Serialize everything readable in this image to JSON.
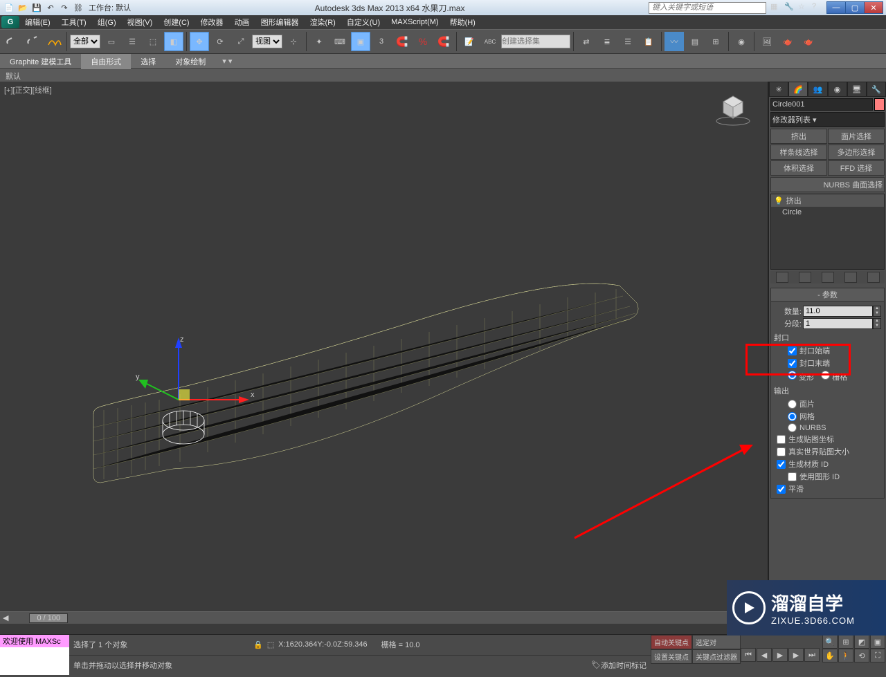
{
  "titlebar": {
    "workspace_label": "工作台: 默认",
    "title": "Autodesk 3ds Max  2013 x64     水果刀.max",
    "search_placeholder": "键入关键字或短语"
  },
  "menu": {
    "items": [
      "编辑(E)",
      "工具(T)",
      "组(G)",
      "视图(V)",
      "创建(C)",
      "修改器",
      "动画",
      "图形编辑器",
      "渲染(R)",
      "自定义(U)",
      "MAXScript(M)",
      "帮助(H)"
    ]
  },
  "maintb": {
    "filter": "全部",
    "view_dd": "视图",
    "named_set_placeholder": "创建选择集"
  },
  "shelf": {
    "tabs": [
      "Graphite 建模工具",
      "自由形式",
      "选择",
      "对象绘制"
    ],
    "active": 1,
    "sub": "默认"
  },
  "viewport": {
    "label": "[+][正交][线框]"
  },
  "cmd_panel": {
    "object_name": "Circle001",
    "modlist_label": "修改器列表",
    "mod_buttons": [
      "挤出",
      "面片选择",
      "样条线选择",
      "多边形选择",
      "体积选择",
      "FFD 选择"
    ],
    "mod_row": "NURBS 曲面选择",
    "stack": {
      "header": "挤出",
      "item": "Circle"
    },
    "params": {
      "rollout": "参数",
      "amount_label": "数量:",
      "amount_value": "11.0",
      "segments_label": "分段:",
      "segments_value": "1",
      "cap_label": "封口",
      "cap_start": "封口始端",
      "cap_end": "封口末端",
      "morph": "变形",
      "grid": "栅格",
      "output_label": "输出",
      "out_patch": "面片",
      "out_mesh": "网格",
      "out_nurbs": "NURBS",
      "gen_map": "生成贴图坐标",
      "real_world": "真实世界贴图大小",
      "gen_mat_id": "生成材质 ID",
      "use_shape_id": "使用图形 ID",
      "smooth": "平滑"
    }
  },
  "timeslider": {
    "pos": "0 / 100"
  },
  "status": {
    "selected": "选择了 1 个对象",
    "prompt": "单击并拖动以选择并移动对象",
    "x": "1620.364",
    "y": "-0.0",
    "z": "59.346",
    "grid": "栅格 = 10.0",
    "add_time_tag": "添加时间标记",
    "auto_key": "自动关键点",
    "set_key": "设置关键点",
    "key_filter": "关键点过滤器",
    "sel_label": "选定对"
  },
  "script": {
    "welcome": "欢迎使用 MAXSc"
  },
  "watermark": {
    "t1": "溜溜自学",
    "t2": "ZIXUE.3D66.COM"
  }
}
